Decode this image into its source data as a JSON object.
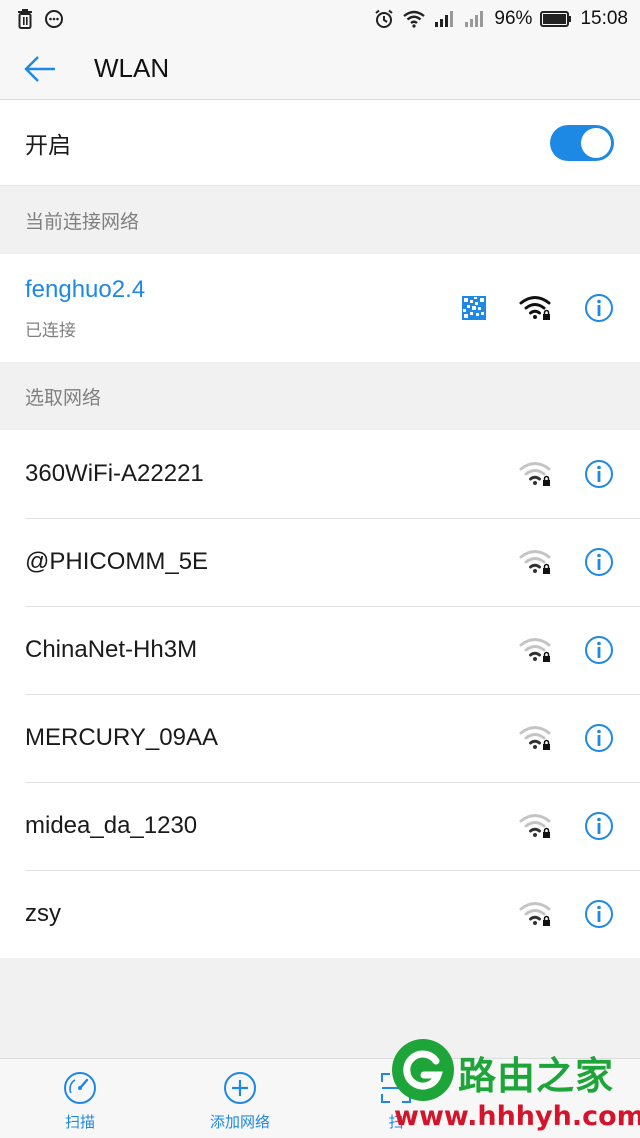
{
  "status_bar": {
    "battery": "96%",
    "time": "15:08",
    "left_icons": [
      "trash-icon",
      "message-icon"
    ],
    "right_icons": [
      "alarm-icon",
      "wifi-icon",
      "signal-icon",
      "signal-icon",
      "battery-icon"
    ]
  },
  "app_bar": {
    "title": "WLAN"
  },
  "wlan_switch": {
    "label": "开启",
    "enabled": true
  },
  "current_section": {
    "header": "当前连接网络",
    "network": {
      "ssid": "fenghuo2.4",
      "status": "已连接"
    }
  },
  "choose_section": {
    "header": "选取网络",
    "networks": [
      {
        "ssid": "360WiFi-A22221"
      },
      {
        "ssid": "@PHICOMM_5E"
      },
      {
        "ssid": "ChinaNet-Hh3M"
      },
      {
        "ssid": "MERCURY_09AA"
      },
      {
        "ssid": "midea_da_1230"
      },
      {
        "ssid": "zsy"
      }
    ]
  },
  "bottom_bar": {
    "items": [
      {
        "label": "扫描",
        "icon": "scan-gauge-icon"
      },
      {
        "label": "添加网络",
        "icon": "add-circle-icon"
      },
      {
        "label": "扫",
        "icon": "qr-scan-icon"
      }
    ]
  },
  "watermark": {
    "title": "路由之家",
    "url": "www.hhhyh.com"
  },
  "colors": {
    "accent": "#1e88e5",
    "watermark_green": "#1ea53a",
    "watermark_red": "#d4142a"
  }
}
